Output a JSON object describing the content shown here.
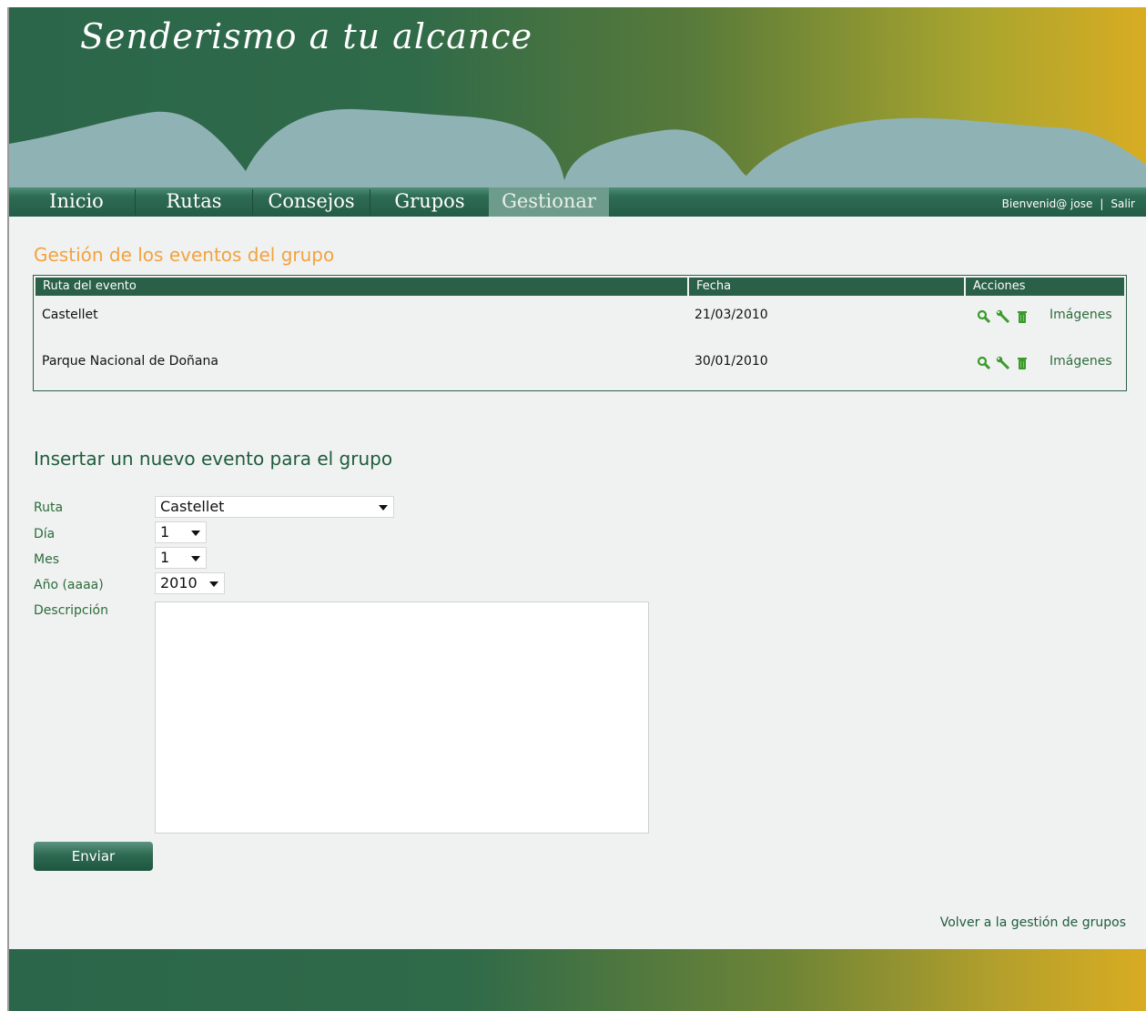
{
  "header": {
    "site_title": "Senderismo a tu alcance"
  },
  "nav": {
    "items": [
      {
        "label": "Inicio",
        "active": false
      },
      {
        "label": "Rutas",
        "active": false
      },
      {
        "label": "Consejos",
        "active": false
      },
      {
        "label": "Grupos",
        "active": false
      },
      {
        "label": "Gestionar",
        "active": true
      }
    ],
    "welcome": "Bienvenid@ jose",
    "separator": "|",
    "logout": "Salir"
  },
  "events": {
    "title": "Gestión de los eventos del grupo",
    "columns": [
      "Ruta del evento",
      "Fecha",
      "Acciones"
    ],
    "rows": [
      {
        "ruta": "Castellet",
        "fecha": "21/03/2010",
        "images_link": "Imágenes"
      },
      {
        "ruta": "Parque Nacional de Doñana",
        "fecha": "30/01/2010",
        "images_link": "Imágenes"
      }
    ],
    "action_icons": [
      "search-icon",
      "wrench-icon",
      "trash-icon"
    ]
  },
  "new_event": {
    "title": "Insertar un nuevo evento para el grupo",
    "fields": {
      "ruta": {
        "label": "Ruta",
        "value": "Castellet"
      },
      "dia": {
        "label": "Día",
        "value": "1"
      },
      "mes": {
        "label": "Mes",
        "value": "1"
      },
      "anio": {
        "label": "Año (aaaa)",
        "value": "2010"
      },
      "descripcion": {
        "label": "Descripción",
        "value": ""
      }
    },
    "submit_label": "Enviar"
  },
  "back_link": "Volver a la gestión de grupos",
  "colors": {
    "brand_green": "#2a5f48",
    "accent_orange": "#f3a23e",
    "header_gold": "#d9ac22",
    "link_green": "#2d6c3c"
  }
}
